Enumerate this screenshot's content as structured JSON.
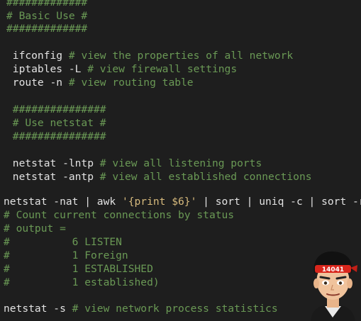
{
  "lines": [
    {
      "id": "l0",
      "parts": [
        {
          "t": "#############",
          "c": "comment"
        }
      ]
    },
    {
      "id": "l1",
      "parts": [
        {
          "t": "# Basic Use #",
          "c": "comment"
        }
      ]
    },
    {
      "id": "l2",
      "parts": [
        {
          "t": "#############",
          "c": "comment"
        }
      ]
    },
    {
      "id": "l3",
      "parts": []
    },
    {
      "id": "l4",
      "parts": [
        {
          "t": " ifconfig ",
          "c": "cmd"
        },
        {
          "t": "# view the properties of all network",
          "c": "comment"
        }
      ]
    },
    {
      "id": "l5",
      "parts": [
        {
          "t": " iptables -L ",
          "c": "cmd"
        },
        {
          "t": "# view firewall settings",
          "c": "comment"
        }
      ]
    },
    {
      "id": "l6",
      "parts": [
        {
          "t": " route -n ",
          "c": "cmd"
        },
        {
          "t": "# view routing table",
          "c": "comment"
        }
      ]
    },
    {
      "id": "l7",
      "parts": []
    },
    {
      "id": "l8",
      "parts": [
        {
          "t": " ###############",
          "c": "comment"
        }
      ]
    },
    {
      "id": "l9",
      "parts": [
        {
          "t": " # Use netstat #",
          "c": "comment"
        }
      ]
    },
    {
      "id": "l10",
      "parts": [
        {
          "t": " ###############",
          "c": "comment"
        }
      ]
    },
    {
      "id": "l11",
      "parts": []
    },
    {
      "id": "l12",
      "parts": [
        {
          "t": " netstat -lntp ",
          "c": "cmd"
        },
        {
          "t": "# view all listening ports",
          "c": "comment"
        }
      ]
    },
    {
      "id": "l13",
      "parts": [
        {
          "t": " netstat -antp ",
          "c": "cmd"
        },
        {
          "t": "# view all established connections",
          "c": "comment"
        }
      ]
    },
    {
      "id": "l14",
      "parts": []
    },
    {
      "id": "l15",
      "parts": [
        {
          "t": "netstat -nat | awk ",
          "c": "cmd"
        },
        {
          "t": "'{print $6}'",
          "c": "str"
        },
        {
          "t": " | sort | uniq -c | sort -rn",
          "c": "cmd"
        }
      ]
    },
    {
      "id": "l16",
      "parts": [
        {
          "t": "# Count current connections by status",
          "c": "comment"
        }
      ]
    },
    {
      "id": "l17",
      "parts": [
        {
          "t": "# output =",
          "c": "comment"
        }
      ]
    },
    {
      "id": "l18",
      "parts": [
        {
          "t": "#          6 LISTEN",
          "c": "comment"
        }
      ]
    },
    {
      "id": "l19",
      "parts": [
        {
          "t": "#          1 Foreign",
          "c": "comment"
        }
      ]
    },
    {
      "id": "l20",
      "parts": [
        {
          "t": "#          1 ESTABLISHED",
          "c": "comment"
        }
      ]
    },
    {
      "id": "l21",
      "parts": [
        {
          "t": "#          1 established)",
          "c": "comment"
        }
      ]
    },
    {
      "id": "l22",
      "parts": []
    },
    {
      "id": "l23",
      "parts": [
        {
          "t": "netstat -s ",
          "c": "cmd"
        },
        {
          "t": "# view network process statistics",
          "c": "comment"
        }
      ]
    }
  ],
  "avatar": {
    "badge_text": "14041"
  },
  "colors": {
    "background": "#1e1e1e",
    "text": "#e2e2e2",
    "comment": "#6a9955",
    "string": "#d7ba7d"
  }
}
